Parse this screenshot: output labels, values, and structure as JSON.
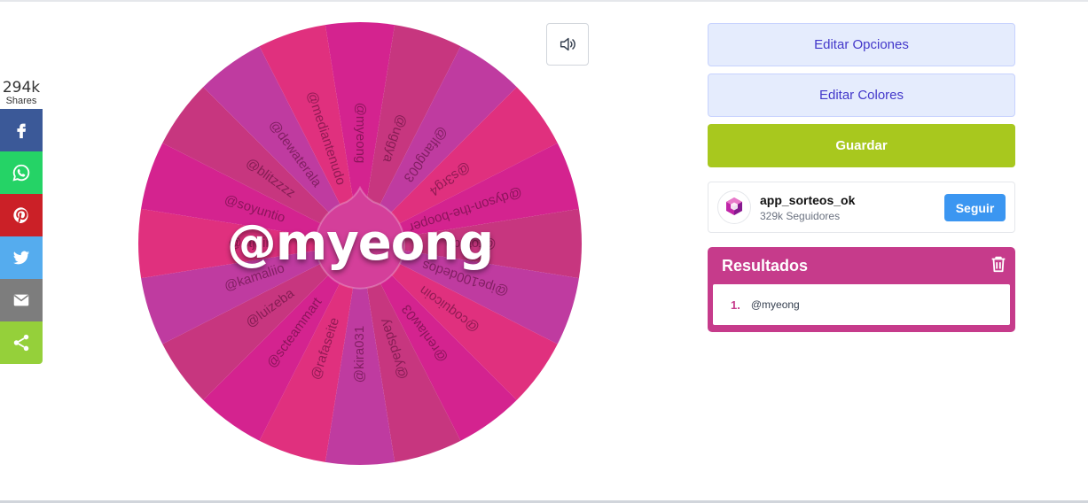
{
  "share": {
    "count": "294k",
    "label": "Shares",
    "buttons": [
      {
        "name": "facebook",
        "icon": "facebook-icon",
        "color": "#3b5998"
      },
      {
        "name": "whatsapp",
        "icon": "whatsapp-icon",
        "color": "#25d366"
      },
      {
        "name": "pinterest",
        "icon": "pinterest-icon",
        "color": "#cb2027"
      },
      {
        "name": "twitter",
        "icon": "twitter-icon",
        "color": "#55acee"
      },
      {
        "name": "email",
        "icon": "email-icon",
        "color": "#7d7d7d"
      },
      {
        "name": "sharethis",
        "icon": "share-icon",
        "color": "#95d03a"
      }
    ]
  },
  "wheel": {
    "winner": "@myeong",
    "sound_icon": "speaker-icon",
    "segment_colors": [
      "#d4238f",
      "#c7367f",
      "#bf3ba0",
      "#e0307e"
    ],
    "segments": [
      "@myeong",
      "@uggya",
      "@lfang003",
      "@s3rg4",
      "@dyson-the-booper",
      "@totodo",
      "@ipe100dedos",
      "@coquicoin",
      "@renlaw03",
      "@yepspey",
      "@kira031",
      "@rafaseite",
      "@scteammart",
      "@luizeba",
      "@kamaliio",
      "@stjbir",
      "@soyuntio",
      "@blitzzzz",
      "@dewaterala",
      "@mediantenudo"
    ]
  },
  "panel": {
    "edit_options": "Editar Opciones",
    "edit_colors": "Editar Colores",
    "save": "Guardar",
    "profile": {
      "name": "app_sorteos_ok",
      "followers": "329k Seguidores",
      "follow": "Seguir"
    },
    "results": {
      "title": "Resultados",
      "items": [
        {
          "num": "1.",
          "value": "@myeong"
        }
      ]
    }
  }
}
